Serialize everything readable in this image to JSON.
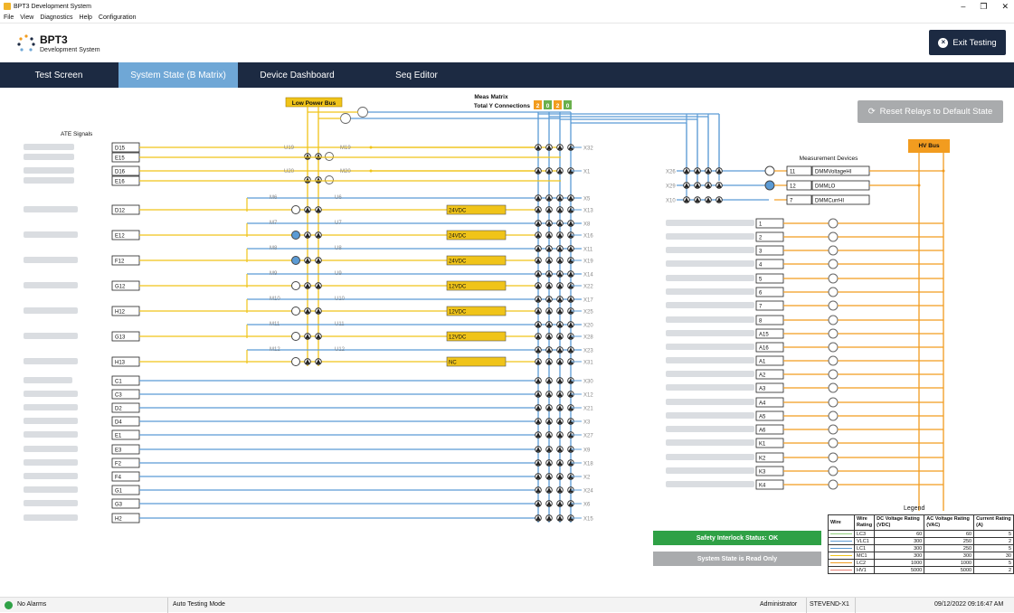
{
  "window": {
    "title": "BPT3 Development System",
    "controls": [
      "–",
      "❐",
      "✕"
    ]
  },
  "menu": [
    "File",
    "View",
    "Diagnostics",
    "Help",
    "Configuration"
  ],
  "header": {
    "title": "BPT3",
    "subtitle": "Development System",
    "exit_label": "Exit Testing"
  },
  "tabs": [
    {
      "label": "Test Screen",
      "active": false
    },
    {
      "label": "System State (B Matrix)",
      "active": true
    },
    {
      "label": "Device Dashboard",
      "active": false
    },
    {
      "label": "Seq Editor",
      "active": false
    }
  ],
  "reset_label": "Reset Relays to Default State",
  "labels": {
    "ate_signals": "ATE Signals",
    "low_power_bus": "Low Power Bus",
    "meas_matrix": "Meas Matrix",
    "total_y": "Total Y Connections",
    "measurement_devices": "Measurement Devices",
    "hv_bus": "HV Bus"
  },
  "y_connections": [
    {
      "value": "2",
      "color": "#f29c1f"
    },
    {
      "value": "0",
      "color": "#6ab04c"
    },
    {
      "value": "2",
      "color": "#f29c1f"
    },
    {
      "value": "0",
      "color": "#6ab04c"
    }
  ],
  "signals": [
    {
      "pin": "D15",
      "x": "X32",
      "relay": "U19",
      "m": "M19",
      "group": "top"
    },
    {
      "pin": "E15",
      "x": "",
      "relay": "",
      "m": "",
      "group": "top"
    },
    {
      "pin": "D16",
      "x": "X1",
      "relay": "U20",
      "m": "M20",
      "group": "top"
    },
    {
      "pin": "E16",
      "x": "",
      "relay": "",
      "m": "",
      "group": "top"
    },
    {
      "pin": "D12",
      "x": "X13",
      "x2": "X5",
      "relay": "U6",
      "m": "M6",
      "supply": "24VDC",
      "group": "supply"
    },
    {
      "pin": "E12",
      "x": "X16",
      "x2": "X8",
      "relay": "U7",
      "m": "M7",
      "supply": "24VDC",
      "group": "supply"
    },
    {
      "pin": "F12",
      "x": "X19",
      "x2": "X11",
      "relay": "U8",
      "m": "M8",
      "supply": "24VDC",
      "group": "supply"
    },
    {
      "pin": "G12",
      "x": "X22",
      "x2": "X14",
      "relay": "U9",
      "m": "M9",
      "supply": "12VDC",
      "group": "supply"
    },
    {
      "pin": "H12",
      "x": "X25",
      "x2": "X17",
      "relay": "U10",
      "m": "M10",
      "supply": "12VDC",
      "group": "supply"
    },
    {
      "pin": "G13",
      "x": "X28",
      "x2": "X20",
      "relay": "U11",
      "m": "M11",
      "supply": "12VDC",
      "group": "supply"
    },
    {
      "pin": "H13",
      "x": "X31",
      "x2": "X23",
      "relay": "U12",
      "m": "M12",
      "supply": "NC",
      "group": "supply"
    },
    {
      "pin": "C1",
      "x": "X30",
      "group": "plain"
    },
    {
      "pin": "C3",
      "x": "X12",
      "group": "plain"
    },
    {
      "pin": "D2",
      "x": "X21",
      "group": "plain"
    },
    {
      "pin": "D4",
      "x": "X3",
      "group": "plain"
    },
    {
      "pin": "E1",
      "x": "X27",
      "group": "plain"
    },
    {
      "pin": "E3",
      "x": "X9",
      "group": "plain"
    },
    {
      "pin": "F2",
      "x": "X18",
      "group": "plain"
    },
    {
      "pin": "F4",
      "x": "X2",
      "group": "plain"
    },
    {
      "pin": "G1",
      "x": "X24",
      "group": "plain"
    },
    {
      "pin": "G3",
      "x": "X6",
      "group": "plain"
    },
    {
      "pin": "H2",
      "x": "X15",
      "group": "plain"
    }
  ],
  "meas_devices": [
    {
      "x": "X26",
      "num": "11",
      "name": "DMMVoltageHI"
    },
    {
      "x": "X29",
      "num": "12",
      "name": "DMMLO"
    },
    {
      "x": "X10",
      "num": "7",
      "name": "DMMCurrHI"
    }
  ],
  "hv_channels": [
    "1",
    "2",
    "3",
    "4",
    "5",
    "6",
    "7",
    "8",
    "A15",
    "A16",
    "A1",
    "A2",
    "A3",
    "A4",
    "A5",
    "A6",
    "K1",
    "K2",
    "K3",
    "K4"
  ],
  "safety": {
    "interlock_label": "Safety Interlock Status: OK",
    "interlock_color": "#2fa146",
    "readonly_label": "System State is Read Only",
    "readonly_color": "#a9abad"
  },
  "legend": {
    "title": "Legend",
    "headers": [
      "Wire",
      "Wire Rating",
      "DC Voltage Rating (VDC)",
      "AC Voltage Rating (VAC)",
      "Current Rating (A)"
    ],
    "rows": [
      {
        "name": "LC3",
        "dc": "60",
        "ac": "60",
        "current": "5",
        "color": "#8fcf7a"
      },
      {
        "name": "VLC1",
        "dc": "300",
        "ac": "250",
        "current": "2",
        "color": "#5b9bd5"
      },
      {
        "name": "LC1",
        "dc": "300",
        "ac": "250",
        "current": "5",
        "color": "#5b9bd5"
      },
      {
        "name": "MC1",
        "dc": "300",
        "ac": "300",
        "current": "30",
        "color": "#f0c419"
      },
      {
        "name": "LC2",
        "dc": "1000",
        "ac": "1000",
        "current": "5",
        "color": "#f29c1f"
      },
      {
        "name": "HV1",
        "dc": "5000",
        "ac": "5000",
        "current": "2",
        "color": "#e67e73"
      }
    ]
  },
  "status": {
    "alarms": "No Alarms",
    "mode": "Auto Testing Mode",
    "user": "Administrator",
    "station": "STEVEND-X1",
    "datetime": "09/12/2022 09:16:47 AM"
  },
  "colors": {
    "navy": "#1c2a42",
    "active_tab": "#6fa7d6",
    "blue_wire": "#5b9bd5",
    "yellow_wire": "#f0c419",
    "orange_wire": "#f29c1f",
    "supply_box": "#f0c419"
  }
}
